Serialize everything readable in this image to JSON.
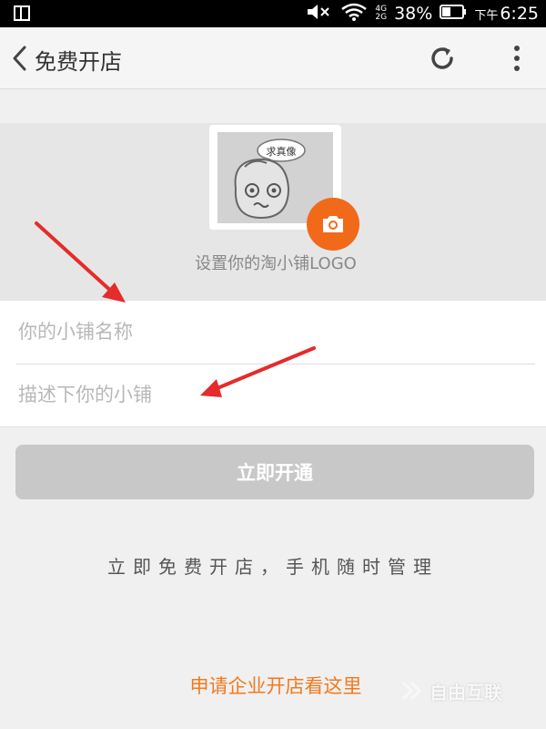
{
  "status_bar": {
    "network_top": "4G",
    "network_bottom": "2G",
    "battery": "38%",
    "time_prefix": "下午",
    "time": "6:25"
  },
  "header": {
    "title": "免费开店",
    "icons": [
      "back-arrow",
      "refresh",
      "more-vertical"
    ]
  },
  "logo": {
    "badge_text": "求真像",
    "caption": "设置你的淘小铺LOGO",
    "camera_color": "#f06a1a"
  },
  "form": {
    "name_placeholder": "你的小铺名称",
    "name_value": "",
    "desc_placeholder": "描述下你的小铺",
    "desc_value": ""
  },
  "submit": {
    "label": "立即开通",
    "color": "#c8c8c8"
  },
  "slogan": "立即免费开店，手机随时管理",
  "enterprise_link": "申请企业开店看这里",
  "watermark": "自由互联",
  "accent_color": "#f07a1e",
  "annotation_color": "#e52b2b"
}
